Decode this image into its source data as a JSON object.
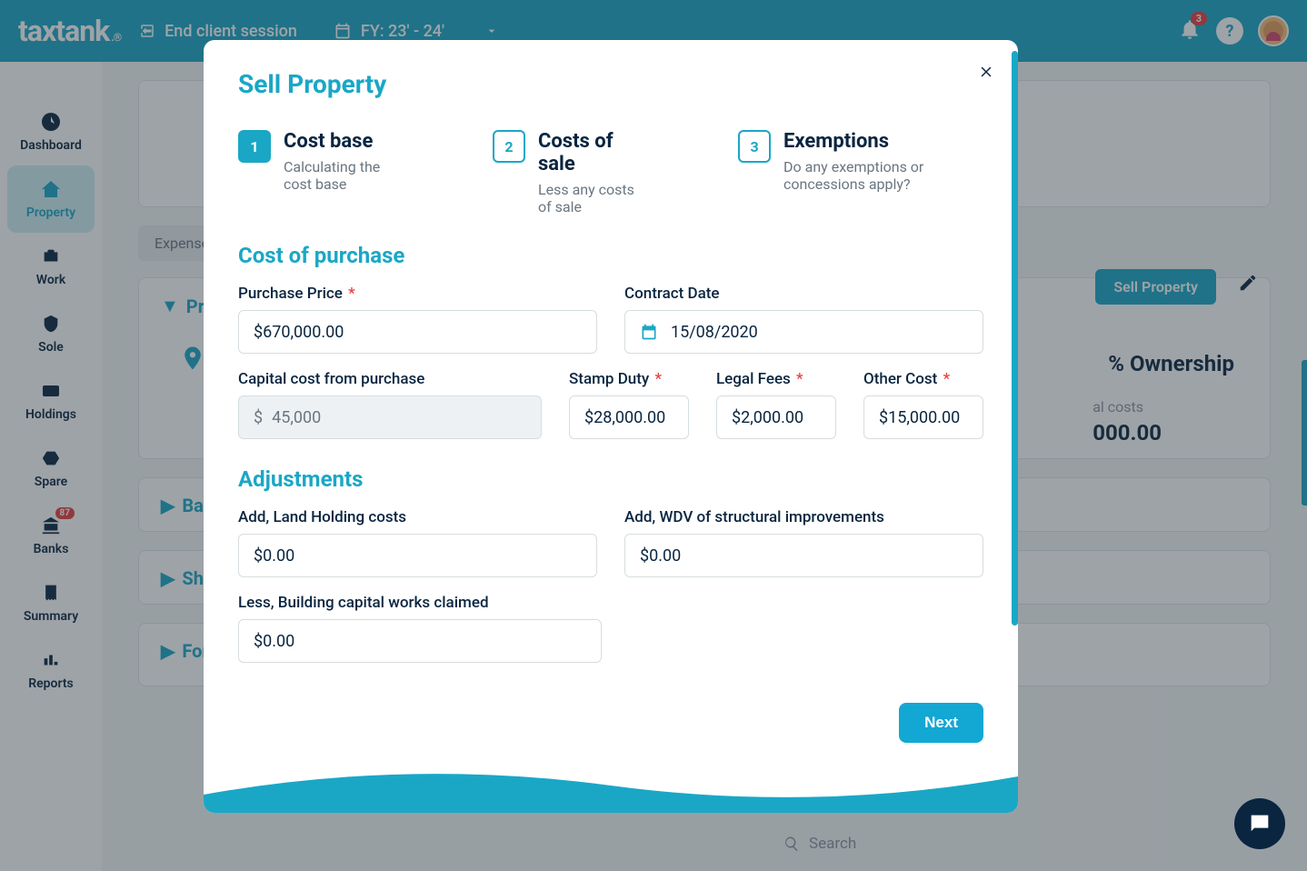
{
  "header": {
    "logo_main": "taxtank",
    "logo_reg": ".®",
    "end_session": "End client session",
    "fy_label": "FY: 23' - 24'",
    "notif_count": "3",
    "help": "?"
  },
  "sidebar": {
    "items": [
      {
        "label": "Dashboard"
      },
      {
        "label": "Property"
      },
      {
        "label": "Work"
      },
      {
        "label": "Sole"
      },
      {
        "label": "Holdings"
      },
      {
        "label": "Spare"
      },
      {
        "label": "Banks",
        "badge": "87"
      },
      {
        "label": "Summary"
      },
      {
        "label": "Reports"
      }
    ]
  },
  "background": {
    "tab_expenses": "Expenses",
    "prop_header": "Prop",
    "bank_header": "Ban",
    "share_header": "Sha",
    "forecast_header": "Forecasting Details",
    "sell_btn": "Sell Property",
    "ownership_title": "% Ownership",
    "al_costs_label": "al costs",
    "amount_partial": "000.00",
    "search_placeholder": "Search"
  },
  "modal": {
    "title": "Sell Property",
    "steps": [
      {
        "num": "1",
        "label": "Cost base",
        "desc": "Calculating the cost base"
      },
      {
        "num": "2",
        "label": "Costs of sale",
        "desc": "Less any costs of sale"
      },
      {
        "num": "3",
        "label": "Exemptions",
        "desc": "Do any exemptions or concessions apply?"
      }
    ],
    "sections": {
      "cost_of_purchase": "Cost of purchase",
      "adjustments": "Adjustments"
    },
    "fields": {
      "purchase_price_label": "Purchase Price",
      "purchase_price_value": "$670,000.00",
      "contract_date_label": "Contract Date",
      "contract_date_value": "15/08/2020",
      "capital_cost_label": "Capital cost from purchase",
      "capital_cost_value": "45,000",
      "stamp_duty_label": "Stamp Duty",
      "stamp_duty_value": "$28,000.00",
      "legal_fees_label": "Legal Fees",
      "legal_fees_value": "$2,000.00",
      "other_cost_label": "Other Cost",
      "other_cost_value": "$15,000.00",
      "land_holding_label": "Add, Land Holding costs",
      "land_holding_value": "$0.00",
      "wdv_label": "Add, WDV of structural improvements",
      "wdv_value": "$0.00",
      "capital_works_label": "Less, Building capital works claimed",
      "capital_works_value": "$0.00"
    },
    "next_button": "Next"
  }
}
